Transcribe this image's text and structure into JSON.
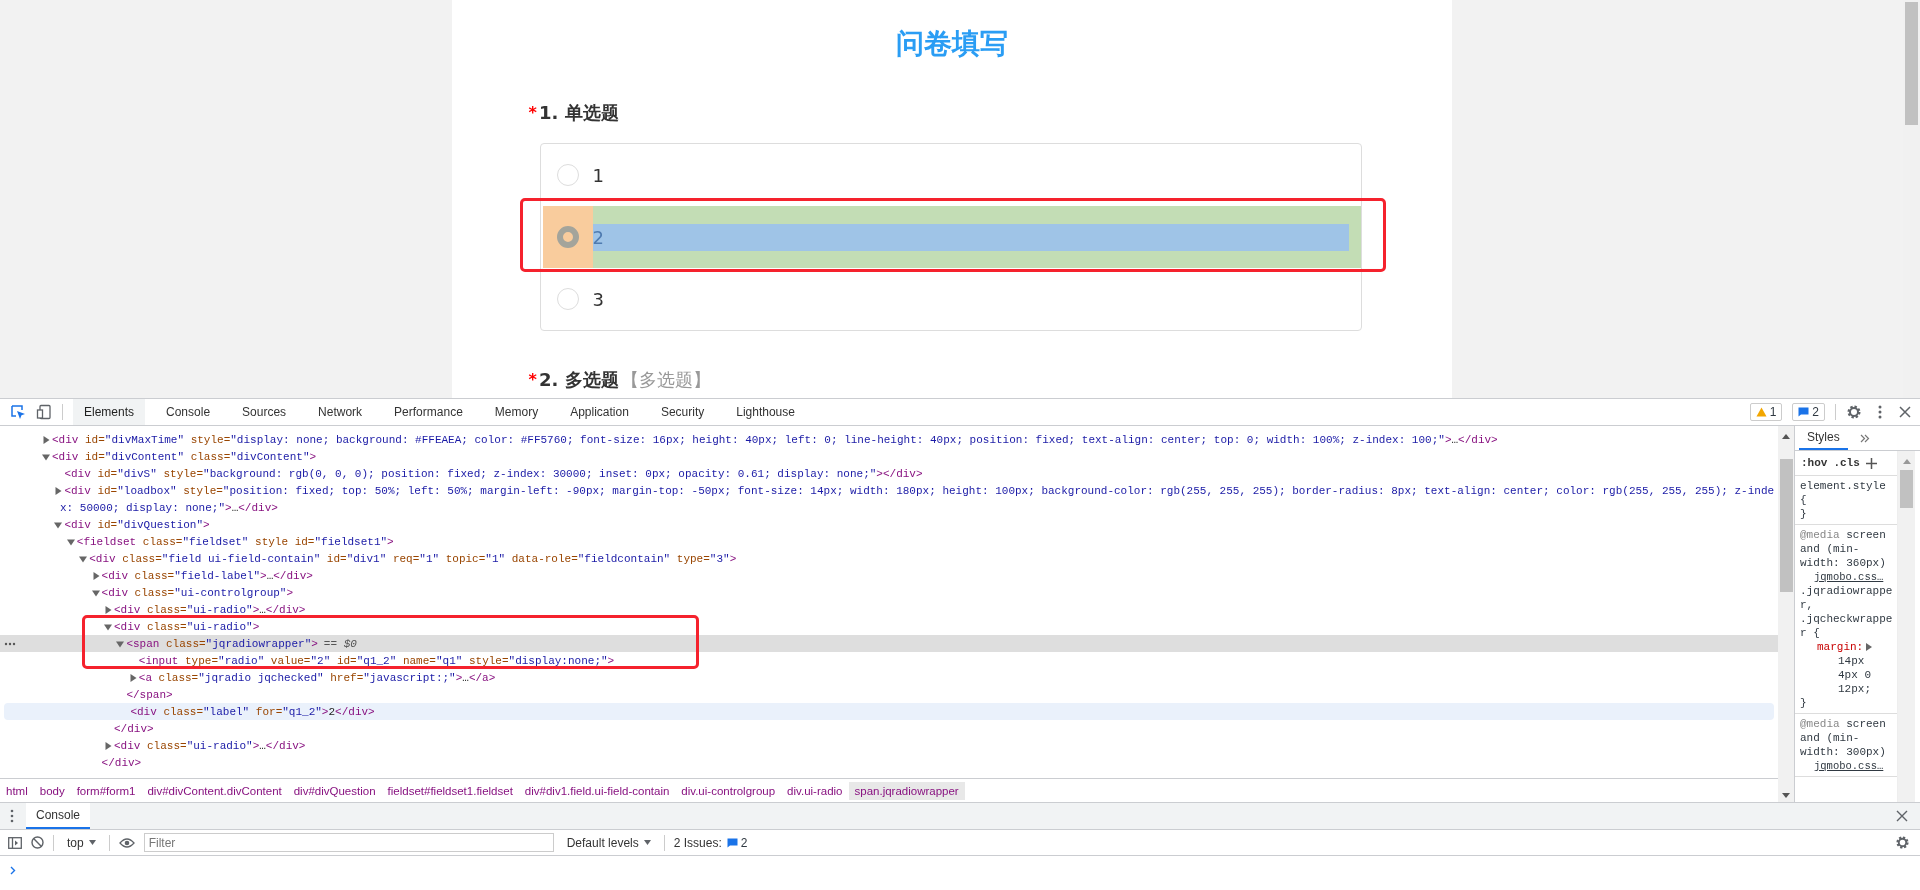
{
  "page": {
    "title": "问卷填写",
    "questions": [
      {
        "mark": "*",
        "title": "1. 单选题",
        "options": [
          {
            "label": "1",
            "selected": false,
            "inspected": false
          },
          {
            "label": "2",
            "selected": true,
            "inspected": true
          },
          {
            "label": "3",
            "selected": false,
            "inspected": false
          }
        ]
      },
      {
        "mark": "*",
        "title": "2. 多选题",
        "tag": "【多选题】"
      }
    ]
  },
  "devtools": {
    "tabs": [
      {
        "label": "Elements",
        "selected": true
      },
      {
        "label": "Console",
        "selected": false
      },
      {
        "label": "Sources",
        "selected": false
      },
      {
        "label": "Network",
        "selected": false
      },
      {
        "label": "Performance",
        "selected": false
      },
      {
        "label": "Memory",
        "selected": false
      },
      {
        "label": "Application",
        "selected": false
      },
      {
        "label": "Security",
        "selected": false
      },
      {
        "label": "Lighthouse",
        "selected": false
      }
    ],
    "warnings": "1",
    "messages": "2",
    "tree": [
      {
        "text": "<div id=\"divMaxTime\" style=\"display: none; background: #FFEAEA; color: #FF5760; font-size: 16px; height: 40px; left: 0; line-height: 40px; position: fixed; text-align: center; top: 0; width: 100%; z-index: 100;\">…</div>",
        "expanded": false,
        "selected": false
      },
      {
        "text": "<div id=\"divContent\" class=\"divContent\">",
        "expanded": true,
        "selected": false,
        "children": [
          {
            "text": "<div id=\"divS\" style=\"background: rgb(0, 0, 0); position: fixed; z-index: 30000; inset: 0px; opacity: 0.61; display: none;\"></div>",
            "selected": false
          },
          {
            "text": "<div id=\"loadbox\" style=\"position: fixed; top: 50%; left: 50%; margin-left: -90px; margin-top: -50px; font-size: 14px; width: 180px; height: 100px; background-color: rgb(255, 255, 255); border-radius: 8px; text-align: center; color: rgb(255, 255, 255); z-inde",
            "continuation": "x: 50000; display: none;\">…</div>",
            "expanded": false,
            "selected": false
          },
          {
            "text": "<div id=\"divQuestion\">",
            "expanded": true,
            "selected": false,
            "children": [
              {
                "text": "<fieldset class=\"fieldset\" style id=\"fieldset1\">",
                "expanded": true,
                "selected": false,
                "children": [
                  {
                    "text": "<div class=\"field ui-field-contain\" id=\"div1\" req=\"1\" topic=\"1\" data-role=\"fieldcontain\" type=\"3\">",
                    "expanded": true,
                    "selected": false,
                    "children": [
                      {
                        "text": "<div class=\"field-label\">…</div>",
                        "expanded": false,
                        "selected": false
                      },
                      {
                        "text": "<div class=\"ui-controlgroup\">",
                        "expanded": true,
                        "selected": false,
                        "close": "</div>",
                        "children": [
                          {
                            "text": "<div class=\"ui-radio\">…</div>",
                            "expanded": false,
                            "selected": false
                          },
                          {
                            "text": "<div class=\"ui-radio\">",
                            "expanded": true,
                            "selected": false,
                            "close": "</div>",
                            "children": [
                              {
                                "text": "<span class=\"jqradiowrapper\">",
                                "note": "== $0",
                                "expanded": true,
                                "selected": true,
                                "close": "</span>",
                                "children": [
                                  {
                                    "text": "<input type=\"radio\" value=\"2\" id=\"q1_2\" name=\"q1\" style=\"display:none;\">",
                                    "selected": false
                                  },
                                  {
                                    "text": "<a class=\"jqradio jqchecked\" href=\"javascript:;\">…</a>",
                                    "expanded": false,
                                    "selected": false
                                  }
                                ]
                              },
                              {
                                "text": "<div class=\"label\" for=\"q1_2\">2</div>",
                                "selected": false,
                                "hovered": true
                              }
                            ]
                          },
                          {
                            "text": "<div class=\"ui-radio\">…</div>",
                            "expanded": false,
                            "selected": false
                          }
                        ]
                      }
                    ]
                  }
                ]
              }
            ]
          }
        ]
      }
    ],
    "breadcrumbs": [
      {
        "label": "html",
        "selected": false
      },
      {
        "label": "body",
        "selected": false
      },
      {
        "label": "form#form1",
        "selected": false
      },
      {
        "label": "div#divContent.divContent",
        "selected": false
      },
      {
        "label": "div#divQuestion",
        "selected": false
      },
      {
        "label": "fieldset#fieldset1.fieldset",
        "selected": false
      },
      {
        "label": "div#div1.field.ui-field-contain",
        "selected": false
      },
      {
        "label": "div.ui-controlgroup",
        "selected": false
      },
      {
        "label": "div.ui-radio",
        "selected": false
      },
      {
        "label": "span.jqradiowrapper",
        "selected": true
      }
    ],
    "styles": {
      "tab": "Styles",
      "buttons": [
        ":hov",
        ".cls"
      ],
      "rules": [
        {
          "selector": "element.style {",
          "close": "}"
        },
        {
          "media_keyword": "@media",
          "media_query": "screen and (min-width: 360px)",
          "source": "jqmobo.css…",
          "selector": ".jqradiowrapper, .jqcheckwrapper {",
          "declarations": [
            {
              "property": "margin:",
              "value": "14px 4px 0 12px;"
            }
          ],
          "close": "}"
        },
        {
          "media_keyword": "@media",
          "media_query": "screen and (min-width: 300px)",
          "source": "jqmobo.css…"
        }
      ]
    },
    "drawer": {
      "tab": "Console",
      "context": "top",
      "filter_placeholder": "Filter",
      "levels": "Default levels",
      "issues_label": "2 Issues:",
      "issues_count": "2"
    }
  }
}
